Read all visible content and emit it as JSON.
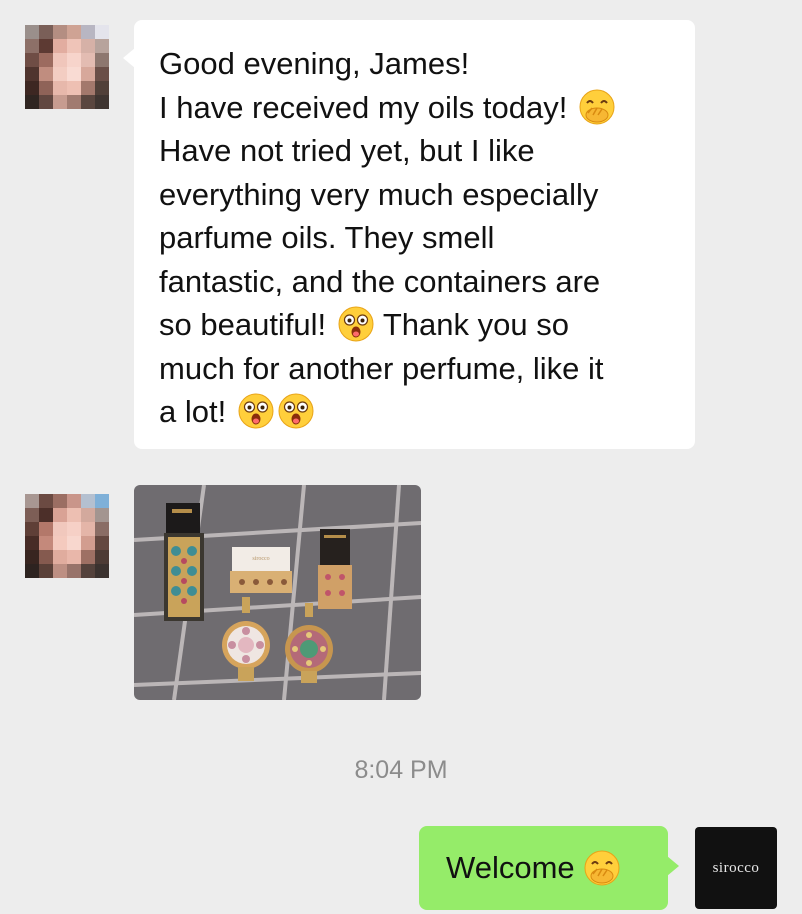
{
  "messages": [
    {
      "from": "customer",
      "lines": [
        "Good evening, James!",
        "I have received my oils today!",
        "Have not tried yet, but I like",
        "everything very much especially",
        "parfume oils. They smell",
        "fantastic, and the containers are",
        "so beautiful!",
        "Thank you so",
        "much for another perfume, like it",
        "a lot!"
      ],
      "emojis": [
        "face-with-hand-over-mouth",
        "astonished-face",
        "astonished-face",
        "astonished-face"
      ]
    },
    {
      "from": "customer",
      "type": "image",
      "image_desc": "photo-of-perfume-oil-bottles-and-boxes"
    }
  ],
  "timestamp": "8:04 PM",
  "reply": {
    "text": "Welcome",
    "emoji": "face-with-hand-over-mouth"
  },
  "brand_avatar_text": "sirocco",
  "colors": {
    "background": "#ededed",
    "incoming_bubble": "#ffffff",
    "outgoing_bubble": "#95ec69",
    "timestamp": "#8c8c8c"
  }
}
